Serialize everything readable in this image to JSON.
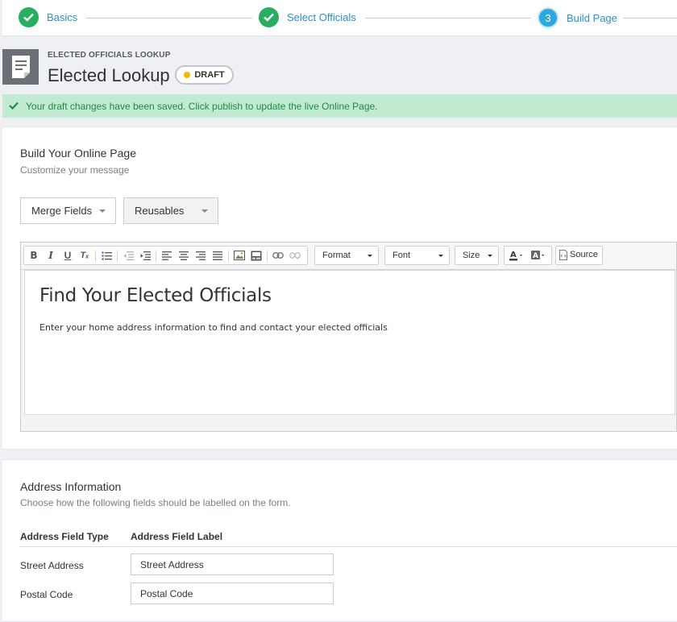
{
  "stepper": {
    "steps": [
      {
        "label": "Basics",
        "state": "done",
        "icon": "check-icon"
      },
      {
        "label": "Select Officials",
        "state": "done",
        "icon": "check-icon"
      },
      {
        "label": "Build Page",
        "state": "current",
        "number": "3"
      }
    ],
    "colors": {
      "done": "#27ae60",
      "current": "#29a9e0",
      "label": "#2b8fc9"
    }
  },
  "header": {
    "icon": "document-icon",
    "type_label": "ELECTED OFFICIALS LOOKUP",
    "title": "Elected Lookup",
    "status_badge": "DRAFT",
    "status_color": "#f5b700"
  },
  "alert": {
    "icon": "check-icon",
    "text": "Your draft changes have been saved. Click publish to update the live Online Page.",
    "color": "#1f8a45",
    "background": "#c1ead0"
  },
  "build_panel": {
    "title": "Build Your Online Page",
    "subtitle": "Customize your message",
    "merge_fields_label": "Merge Fields",
    "reusables_label": "Reusables",
    "toolbar": {
      "format_label": "Format",
      "font_label": "Font",
      "size_label": "Size",
      "source_label": "Source"
    },
    "content": {
      "heading": "Find Your Elected Officials",
      "paragraph": "Enter your home address information to find and contact your elected officials"
    }
  },
  "address_panel": {
    "title": "Address Information",
    "subtitle": "Choose how the following fields should be labelled on the form.",
    "columns": [
      "Address Field Type",
      "Address Field Label"
    ],
    "rows": [
      {
        "type": "Street Address",
        "label": "Street Address"
      },
      {
        "type": "Postal Code",
        "label": "Postal Code"
      }
    ]
  }
}
